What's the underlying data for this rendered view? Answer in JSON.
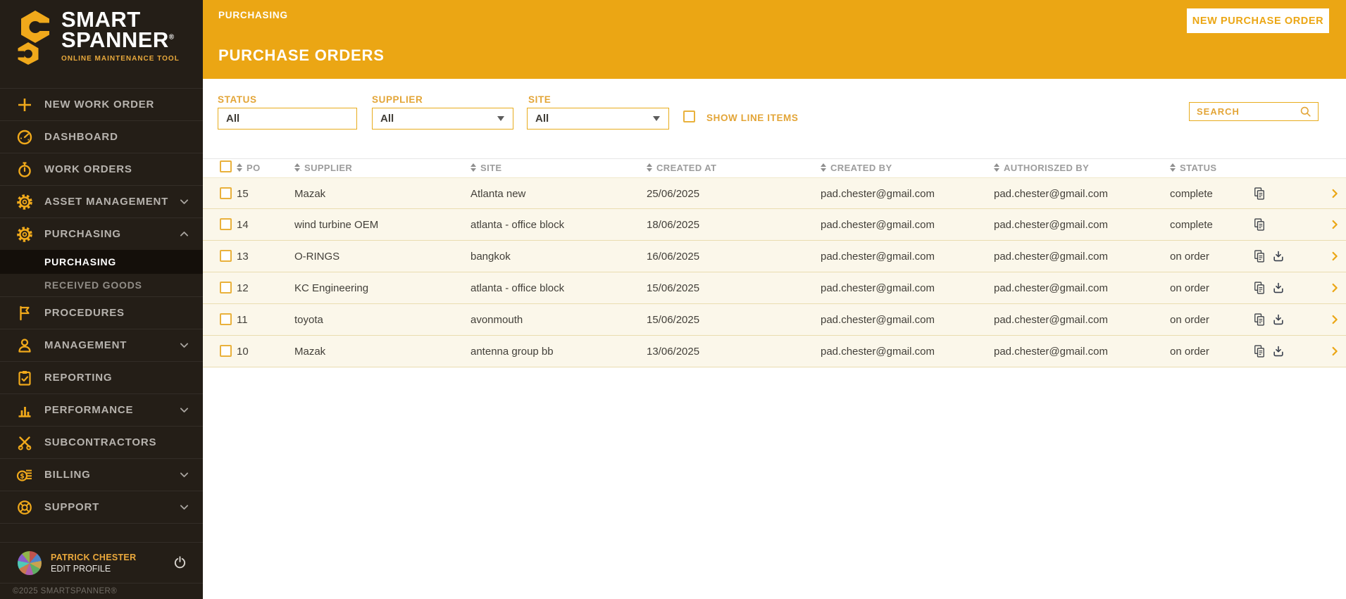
{
  "colors": {
    "gold_accent": "#EBA614",
    "sidebar_bg": "#241E17",
    "row_bg": "#FBF7EA",
    "active_item_bg": "#140F0A"
  },
  "sidebar": {
    "logo": {
      "line1": "SMART",
      "line2": "SPANNER",
      "registered": "®",
      "subtitle": "ONLINE MAINTENANCE TOOL"
    },
    "items": [
      {
        "label": "NEW WORK ORDER",
        "icon": "plus-icon"
      },
      {
        "label": "DASHBOARD",
        "icon": "gauge-icon"
      },
      {
        "label": "WORK ORDERS",
        "icon": "stopwatch-icon"
      },
      {
        "label": "ASSET MANAGEMENT",
        "icon": "gear-icon",
        "chevron": "down"
      },
      {
        "label": "PURCHASING",
        "icon": "gear-icon",
        "chevron": "up",
        "expanded": true,
        "children": [
          {
            "label": "PURCHASING",
            "active": true
          },
          {
            "label": "RECEIVED GOODS",
            "active": false
          }
        ]
      },
      {
        "label": "PROCEDURES",
        "icon": "flag-icon"
      },
      {
        "label": "MANAGEMENT",
        "icon": "person-icon",
        "chevron": "down"
      },
      {
        "label": "REPORTING",
        "icon": "clipboard-icon"
      },
      {
        "label": "PERFORMANCE",
        "icon": "bar-chart-icon",
        "chevron": "down"
      },
      {
        "label": "SUBCONTRACTORS",
        "icon": "tools-icon"
      },
      {
        "label": "BILLING",
        "icon": "coins-icon",
        "chevron": "down"
      },
      {
        "label": "SUPPORT",
        "icon": "lifebuoy-icon",
        "chevron": "down"
      }
    ],
    "profile": {
      "name": "PATRICK CHESTER",
      "edit": "EDIT PROFILE",
      "power_icon": "power-icon"
    },
    "copyright": "©2025 SMARTSPANNER®"
  },
  "header": {
    "breadcrumb": "PURCHASING",
    "title": "PURCHASE ORDERS",
    "new_order_button": "NEW PURCHASE ORDER"
  },
  "filters": {
    "status": {
      "label": "STATUS",
      "value": "All"
    },
    "supplier": {
      "label": "SUPPLIER",
      "value": "All"
    },
    "site": {
      "label": "SITE",
      "value": "All"
    },
    "show_line_items_label": "SHOW LINE ITEMS",
    "search_placeholder": "SEARCH"
  },
  "table": {
    "columns": [
      "PO",
      "SUPPLIER",
      "SITE",
      "CREATED AT",
      "CREATED BY",
      "AUTHORISZED BY",
      "STATUS"
    ],
    "rows": [
      {
        "po": "15",
        "supplier": "Mazak",
        "site": "Atlanta new",
        "created_at": "25/06/2025",
        "created_by": "pad.chester@gmail.com",
        "authorized_by": "pad.chester@gmail.com",
        "status": "complete",
        "has_download": false
      },
      {
        "po": "14",
        "supplier": "wind turbine OEM",
        "site": "atlanta - office block",
        "created_at": "18/06/2025",
        "created_by": "pad.chester@gmail.com",
        "authorized_by": "pad.chester@gmail.com",
        "status": "complete",
        "has_download": false
      },
      {
        "po": "13",
        "supplier": "O-RINGS",
        "site": "bangkok",
        "created_at": "16/06/2025",
        "created_by": "pad.chester@gmail.com",
        "authorized_by": "pad.chester@gmail.com",
        "status": "on order",
        "has_download": true
      },
      {
        "po": "12",
        "supplier": "KC Engineering",
        "site": "atlanta - office block",
        "created_at": "15/06/2025",
        "created_by": "pad.chester@gmail.com",
        "authorized_by": "pad.chester@gmail.com",
        "status": "on order",
        "has_download": true
      },
      {
        "po": "11",
        "supplier": "toyota",
        "site": "avonmouth",
        "created_at": "15/06/2025",
        "created_by": "pad.chester@gmail.com",
        "authorized_by": "pad.chester@gmail.com",
        "status": "on order",
        "has_download": true
      },
      {
        "po": "10",
        "supplier": "Mazak",
        "site": "antenna group bb",
        "created_at": "13/06/2025",
        "created_by": "pad.chester@gmail.com",
        "authorized_by": "pad.chester@gmail.com",
        "status": "on order",
        "has_download": true
      }
    ]
  }
}
